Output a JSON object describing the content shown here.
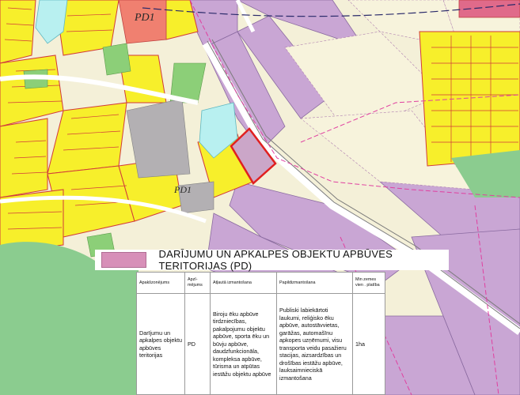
{
  "map": {
    "labels": [
      {
        "id": "pd1-top",
        "text": "PD1"
      },
      {
        "id": "pd1-mid",
        "text": "PD1"
      }
    ],
    "colors": {
      "residential": "#f7ef2b",
      "business_pd": "#c9a6d4",
      "green": "#8ccf78",
      "water": "#b8f0f0",
      "public": "#f08070",
      "industrial": "#b3b0b3",
      "forest": "#8bcc8f",
      "highlight": "#e02020",
      "parcel_lines": "#d23a3a",
      "road": "#ffffff"
    }
  },
  "legend": {
    "swatch_color": "#d78fb8",
    "label": "DARĪJUMU UN APKALPES OBJEKTU APBŪVES TERITORIJAS (PD)"
  },
  "table": {
    "headers": [
      "Apakšzonējums",
      "Apzī-mējums",
      "Atļautā izmantošana",
      "Papildizmantošana",
      "Min zemes vien . platība"
    ],
    "row": {
      "subzone": "Darījumu un apkalpes objektu apbūves teritorijas",
      "code": "PD",
      "allowed": "Biroju ēku apbūve tirdzniecības, pakalpojumu objektu apbūve, sporta ēku un būvju apbūve, daudzfunkcionāla, kompleksa apbūve, tūrisma un atpūtas iestāžu objektu apbūve",
      "additional": "Publiski labiekārtoti laukumi, reliģisko ēku apbūve, autostāvvietas, garāžas, automašīnu apkopes uzņēmumi, visu transporta veidu pasažieru stacijas, aizsardzības un drošības iestāžu apbūve, lauksaimnieciskā izmantošana",
      "min_area": "1ha"
    }
  }
}
